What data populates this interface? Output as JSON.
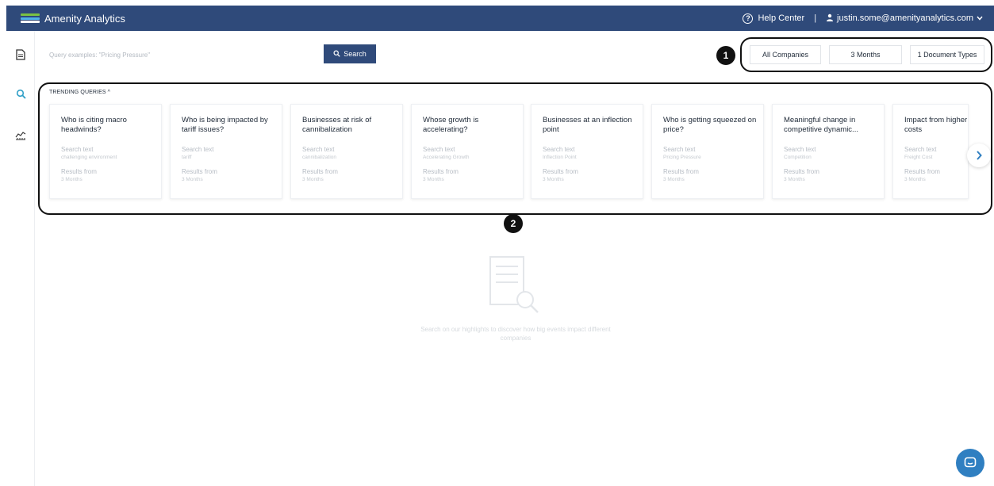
{
  "header": {
    "brand": "Amenity Analytics",
    "help": "Help Center",
    "separator": "|",
    "user": "justin.some@amenityanalytics.com",
    "logo_colors": [
      "#7bc142",
      "#4fb0e6",
      "#ffffff"
    ]
  },
  "sidebar": {
    "items": [
      {
        "icon": "document-icon",
        "active": false
      },
      {
        "icon": "search-icon",
        "active": true
      },
      {
        "icon": "chart-icon",
        "active": false
      }
    ]
  },
  "search": {
    "placeholder": "Query examples: \"Pricing Pressure\"",
    "button_label": "Search"
  },
  "filters": [
    {
      "label": "All Companies"
    },
    {
      "label": "3 Months"
    },
    {
      "label": "1 Document Types"
    }
  ],
  "callouts": [
    "1",
    "2"
  ],
  "trending": {
    "label": "TRENDING QUERIES ^",
    "cards": [
      {
        "title": "Who is citing macro headwinds?",
        "search_label": "Search text",
        "search_text": "challenging environment",
        "results_label": "Results from",
        "results_from": "3 Months"
      },
      {
        "title": "Who is being impacted by tariff issues?",
        "search_label": "Search text",
        "search_text": "tariff",
        "results_label": "Results from",
        "results_from": "3 Months"
      },
      {
        "title": "Businesses at risk of cannibalization",
        "search_label": "Search text",
        "search_text": "cannibalization",
        "results_label": "Results from",
        "results_from": "3 Months"
      },
      {
        "title": "Whose growth is accelerating?",
        "search_label": "Search text",
        "search_text": "Accelerating Growth",
        "results_label": "Results from",
        "results_from": "3 Months"
      },
      {
        "title": "Businesses at an inflection point",
        "search_label": "Search text",
        "search_text": "Inflection Point",
        "results_label": "Results from",
        "results_from": "3 Months"
      },
      {
        "title": "Who is getting squeezed on price?",
        "search_label": "Search text",
        "search_text": "Pricing Pressure",
        "results_label": "Results from",
        "results_from": "3 Months"
      },
      {
        "title": "Meaningful change in competitive dynamic...",
        "search_label": "Search text",
        "search_text": "Competition",
        "results_label": "Results from",
        "results_from": "3 Months"
      },
      {
        "title": "Impact from higher costs",
        "search_label": "Search text",
        "search_text": "Freight Cost",
        "results_label": "Results from",
        "results_from": "3 Months"
      }
    ]
  },
  "empty_state": {
    "message": "Search on our highlights to discover how big events impact different companies"
  },
  "colors": {
    "primary": "#2f4a7a",
    "accent": "#2f7fc1"
  }
}
